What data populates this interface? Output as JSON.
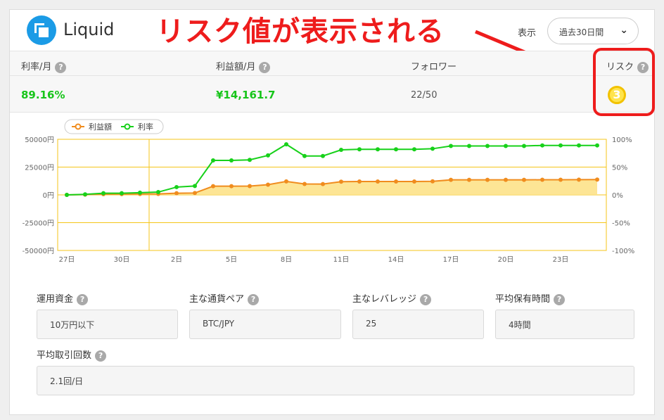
{
  "header": {
    "logo_text": "Liquid",
    "annotation": "リスク値が表示される",
    "display_label": "表示",
    "period_value": "過去30日間"
  },
  "stats": {
    "labels": [
      "利率/月",
      "利益額/月",
      "フォロワー",
      "リスク"
    ],
    "rate": "89.16%",
    "profit": "¥14,161.7",
    "followers": "22/50",
    "risk": "3",
    "help": "?"
  },
  "chart_data": {
    "type": "line",
    "x": [
      "27日",
      "28日",
      "29日",
      "30日",
      "31日",
      "1日",
      "2日",
      "3日",
      "4日",
      "5日",
      "6日",
      "7日",
      "8日",
      "9日",
      "10日",
      "11日",
      "12日",
      "13日",
      "14日",
      "15日",
      "16日",
      "17日",
      "18日",
      "19日",
      "20日",
      "21日",
      "22日",
      "23日",
      "24日",
      "25日"
    ],
    "xticks": [
      "27日",
      "30日",
      "2日",
      "5日",
      "8日",
      "11日",
      "14日",
      "17日",
      "20日",
      "23日"
    ],
    "series": [
      {
        "name": "利益額",
        "axis": "left",
        "color": "#f08c1e",
        "values": [
          0,
          200,
          600,
          700,
          800,
          900,
          1500,
          1700,
          7800,
          7800,
          7900,
          9200,
          12100,
          9800,
          9700,
          11900,
          12000,
          12000,
          12000,
          12000,
          12200,
          13500,
          13500,
          13500,
          13500,
          13500,
          13600,
          13600,
          13700,
          13800
        ]
      },
      {
        "name": "利率",
        "axis": "right",
        "color": "#17d11a",
        "values": [
          0,
          1,
          3,
          3,
          4,
          5,
          14,
          16,
          62,
          62,
          63,
          71,
          91,
          70,
          70,
          81,
          82,
          82,
          82,
          82,
          83,
          88,
          88,
          88,
          88,
          88,
          89,
          89,
          89,
          89
        ]
      }
    ],
    "y_left": {
      "ticks": [
        "50000円",
        "25000円",
        "0円",
        "-25000円",
        "-50000円"
      ],
      "range": [
        -50000,
        50000
      ]
    },
    "y_right": {
      "ticks": [
        "100%",
        "50%",
        "0%",
        "-50%",
        "-100%"
      ],
      "range": [
        -100,
        100
      ]
    },
    "legend_position": "top-left",
    "fill_under": "利益額"
  },
  "info": {
    "capital_label": "運用資金",
    "capital_value": "10万円以下",
    "pair_label": "主な通貨ペア",
    "pair_value": "BTC/JPY",
    "leverage_label": "主なレバレッジ",
    "leverage_value": "25",
    "hold_label": "平均保有時間",
    "hold_value": "4時間",
    "trades_label": "平均取引回数",
    "trades_value": "2.1回/日"
  },
  "colors": {
    "accent_red": "#ee1c1c",
    "profit_green": "#17c51a",
    "chart_frame": "#f5c518",
    "brand_blue": "#1b9be6"
  }
}
